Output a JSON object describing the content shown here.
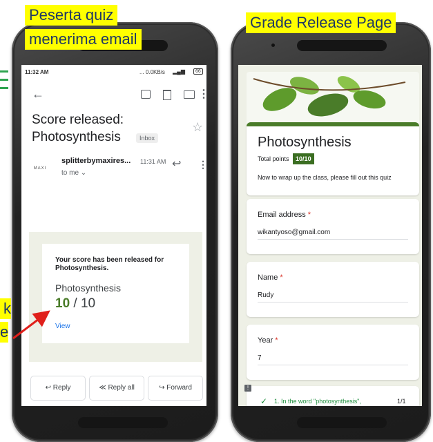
{
  "labels": {
    "left_line1": "Peserta quiz",
    "left_line2": "menerima email",
    "right": "Grade Release Page",
    "partial_k": "k",
    "partial_e": "e"
  },
  "email": {
    "status_time": "11:32 AM",
    "status_right": "... 0.0KB/s",
    "battery": "66",
    "subject_line1": "Score released:",
    "subject_line2": "Photosynthesis",
    "inbox_chip": "Inbox",
    "sender": "splitterbymaxires...",
    "sent_time": "11:31 AM",
    "to": "to me",
    "avatar_text": "MAXI",
    "notice": "Your score has been released for Photosynthesis.",
    "quiz_title": "Photosynthesis",
    "score": "10",
    "score_total": "/ 10",
    "view_link": "View",
    "reply": "Reply",
    "reply_all": "Reply all",
    "forward": "Forward"
  },
  "form": {
    "title": "Photosynthesis",
    "total_points_label": "Total points",
    "total_points_value": "10/10",
    "description": "Now to wrap up the class, please fill out this quiz",
    "fields": [
      {
        "label": "Email address",
        "required": "*",
        "value": "wikantyoso@gmail.com"
      },
      {
        "label": "Name",
        "required": "*",
        "value": "Rudy"
      },
      {
        "label": "Year",
        "required": "*",
        "value": "7"
      }
    ],
    "question": "1. In the word \"photosynthesis\",",
    "question_score": "1/1"
  },
  "colors": {
    "label_bg": "#ffff00",
    "label_text": "#1f3864",
    "accent_green": "#4a7c29",
    "points_badge": "#3b6e22",
    "form_bg": "#eef0e6",
    "link_blue": "#1a73e8",
    "arrow_red": "#e0201b"
  }
}
